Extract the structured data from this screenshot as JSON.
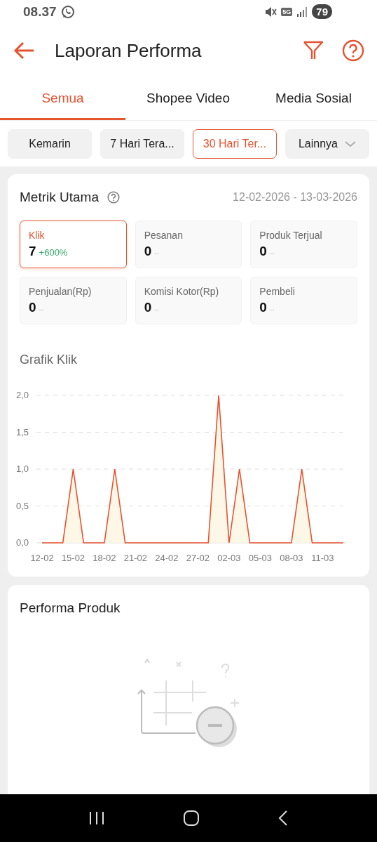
{
  "status_bar": {
    "time": "08.37",
    "network": "5G",
    "battery": "79"
  },
  "header": {
    "title": "Laporan Performa"
  },
  "tabs": [
    {
      "label": "Semua",
      "selected": true
    },
    {
      "label": "Shopee Video",
      "selected": false
    },
    {
      "label": "Media Sosial",
      "selected": false
    }
  ],
  "period_chips": [
    {
      "label": "Kemarin",
      "selected": false,
      "kind": "chip"
    },
    {
      "label": "7 Hari Tera...",
      "selected": false,
      "kind": "chip"
    },
    {
      "label": "30 Hari Ter...",
      "selected": true,
      "kind": "chip"
    },
    {
      "label": "Lainnya",
      "selected": false,
      "kind": "dropdown"
    }
  ],
  "main_metrics": {
    "title": "Metrik Utama",
    "date_range": "12-02-2026 - 13-03-2026",
    "metrics": [
      {
        "label": "Klik",
        "value": "7",
        "change": "+600%",
        "color": "#2fa865",
        "selected": true
      },
      {
        "label": "Pesanan",
        "value": "0",
        "change": "--",
        "color": "#bbbbbb",
        "selected": false
      },
      {
        "label": "Produk Terjual",
        "value": "0",
        "change": "--",
        "color": "#bbbbbb",
        "selected": false
      },
      {
        "label": "Penjualan(Rp)",
        "value": "0",
        "change": "--",
        "color": "#bbbbbb",
        "selected": false
      },
      {
        "label": "Komisi Kotor(Rp)",
        "value": "0",
        "change": "--",
        "color": "#bbbbbb",
        "selected": false
      },
      {
        "label": "Pembeli",
        "value": "0",
        "change": "--",
        "color": "#bbbbbb",
        "selected": false
      }
    ],
    "chart_title": "Grafik Klik",
    "chart_data": {
      "type": "area",
      "categories": [
        "12-02",
        null,
        null,
        "15-02",
        null,
        null,
        "18-02",
        null,
        null,
        "21-02",
        null,
        null,
        "24-02",
        null,
        null,
        "27-02",
        null,
        null,
        "02-03",
        null,
        null,
        "05-03",
        null,
        null,
        "08-03",
        null,
        null,
        "11-03",
        null,
        null
      ],
      "series": [
        {
          "color": "#e5532f",
          "values": [
            0,
            0,
            0,
            1,
            0,
            0,
            0,
            1,
            0,
            0,
            0,
            0,
            0,
            0,
            0,
            0,
            0,
            2,
            0,
            1,
            0,
            0,
            0,
            0,
            0,
            1,
            0,
            0,
            0,
            0
          ]
        }
      ],
      "ylim": [
        0,
        2
      ],
      "grid": true,
      "yticks": [
        {
          "value": 0,
          "label": "0,0"
        },
        {
          "value": 0.5,
          "label": "0,5"
        },
        {
          "value": 1,
          "label": "1,0"
        },
        {
          "value": 1.5,
          "label": "1,5"
        },
        {
          "value": 2,
          "label": "2,0"
        }
      ]
    }
  },
  "product_performance": {
    "title": "Performa Produk"
  }
}
